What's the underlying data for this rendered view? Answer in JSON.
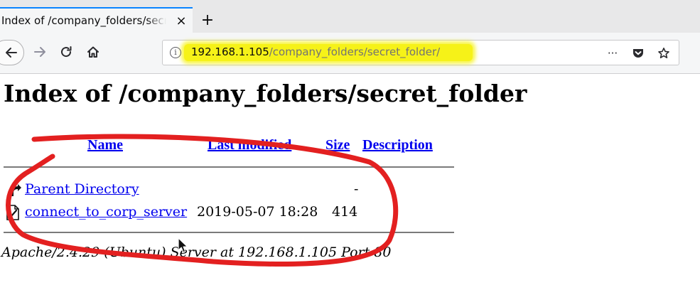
{
  "browser": {
    "tab_title": "Index of /company_folders/secret_folder/",
    "tab_close": "×",
    "new_tab": "+",
    "url_host": "192.168.1.105",
    "url_path": "/company_folders/secret_folder/",
    "more_actions": "···",
    "info_glyph": "i",
    "highlight_color": "#f6f218",
    "icons": [
      "back-arrow-icon",
      "forward-arrow-icon",
      "reload-icon",
      "home-icon",
      "info-icon",
      "pocket-icon",
      "bookmark-star-icon"
    ]
  },
  "page": {
    "title": "Index of /company_folders/secret_folder",
    "columns": {
      "name": "Name",
      "last_modified": "Last modified",
      "size": "Size",
      "description": "Description"
    },
    "rows": [
      {
        "name": "Parent Directory",
        "modified": "",
        "size": "-",
        "icon": "back-folder-icon"
      },
      {
        "name": "connect_to_corp_server",
        "modified": "2019-05-07 18:28",
        "size": "414",
        "icon": "file-icon"
      }
    ],
    "footer": "Apache/2.4.29 (Ubuntu) Server at 192.168.1.105 Port 80"
  },
  "annotation": {
    "color": "#e32020",
    "shape": "red freehand circle"
  }
}
